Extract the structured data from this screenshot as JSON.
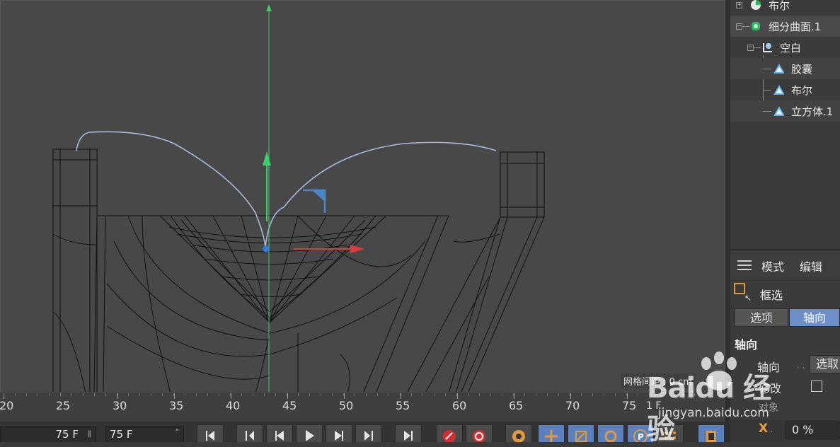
{
  "object_manager": {
    "items": [
      {
        "label": "布尔"
      },
      {
        "label": "细分曲面.1"
      },
      {
        "label": "空白"
      },
      {
        "label": "胶囊"
      },
      {
        "label": "布尔"
      },
      {
        "label": "立方体.1"
      }
    ]
  },
  "attribute_manager": {
    "menu": [
      "模式",
      "编辑"
    ],
    "tool_label": "框选",
    "tabs": [
      "选项",
      "轴向"
    ],
    "active_tab": "轴向",
    "section_title": "轴向",
    "axis_label": "轴向",
    "axis_value": "选取",
    "modify_label": "修改",
    "object_label": "对象",
    "coord_axis": "X",
    "coord_value": "0 %"
  },
  "viewport": {
    "grid_spacing": "网格间距 : 0 cm"
  },
  "timeline": {
    "ticks": [
      "20",
      "25",
      "30",
      "35",
      "40",
      "45",
      "50",
      "55",
      "60",
      "65",
      "70",
      "75"
    ],
    "current_frame": "1 F"
  },
  "transport": {
    "start_frame": "75 F",
    "end_frame": "75 F"
  },
  "watermark": {
    "brand": "Baidu 经验",
    "url": "jingyan.baidu.com"
  },
  "colors": {
    "accent_blue": "#6d8fc7",
    "accent_orange": "#e09a3a",
    "axis_green": "#3ccf6a",
    "axis_red": "#e03a3a"
  }
}
